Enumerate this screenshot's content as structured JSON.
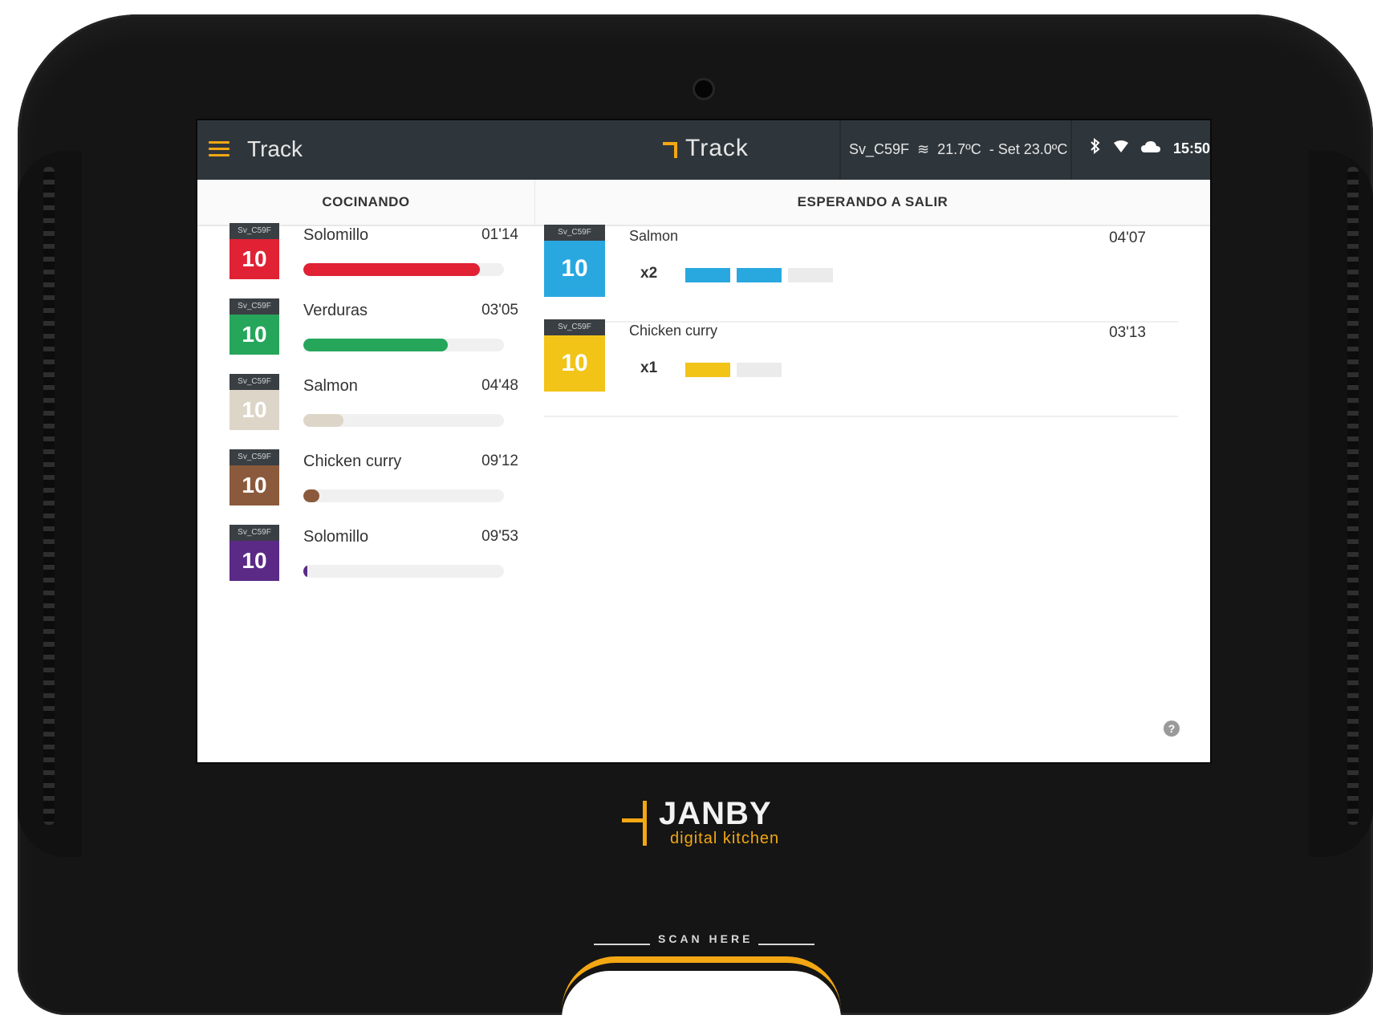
{
  "appbar": {
    "title": "Track",
    "brand": "Track",
    "device_id": "Sv_C59F",
    "temp": "21.7ºC",
    "setpoint": "- Set 23.0ºC",
    "time": "15:50",
    "accent_color": "#f3a712"
  },
  "columns": {
    "cooking_header": "COCINANDO",
    "waiting_header": "ESPERANDO A SALIR"
  },
  "cooking": [
    {
      "tag": "Sv_C59F",
      "num": "10",
      "name": "Solomillo",
      "time": "01'14",
      "color": "#e02234",
      "progress": 0.88
    },
    {
      "tag": "Sv_C59F",
      "num": "10",
      "name": "Verduras",
      "time": "03'05",
      "color": "#26a65b",
      "progress": 0.72
    },
    {
      "tag": "Sv_C59F",
      "num": "10",
      "name": "Salmon",
      "time": "04'48",
      "color": "#ddd6c8",
      "progress": 0.2
    },
    {
      "tag": "Sv_C59F",
      "num": "10",
      "name": "Chicken curry",
      "time": "09'12",
      "color": "#8b5a3c",
      "progress": 0.08
    },
    {
      "tag": "Sv_C59F",
      "num": "10",
      "name": "Solomillo",
      "time": "09'53",
      "color": "#5b2a86",
      "progress": 0.02
    }
  ],
  "waiting": [
    {
      "tag": "Sv_C59F",
      "num": "10",
      "name": "Salmon",
      "time": "04'07",
      "qty": "x2",
      "color": "#29a8e0",
      "filled": 2,
      "empty": 1
    },
    {
      "tag": "Sv_C59F",
      "num": "10",
      "name": "Chicken curry",
      "time": "03'13",
      "qty": "x1",
      "color": "#f2c418",
      "filled": 1,
      "empty": 1
    }
  ],
  "hardware": {
    "logo_name": "JANBY",
    "logo_sub": "digital kitchen",
    "scan_label": "SCAN HERE"
  },
  "icons": [
    "menu-icon",
    "track-logo-icon",
    "wave-icon",
    "bluetooth-icon",
    "wifi-icon",
    "cloud-icon",
    "help-icon"
  ]
}
